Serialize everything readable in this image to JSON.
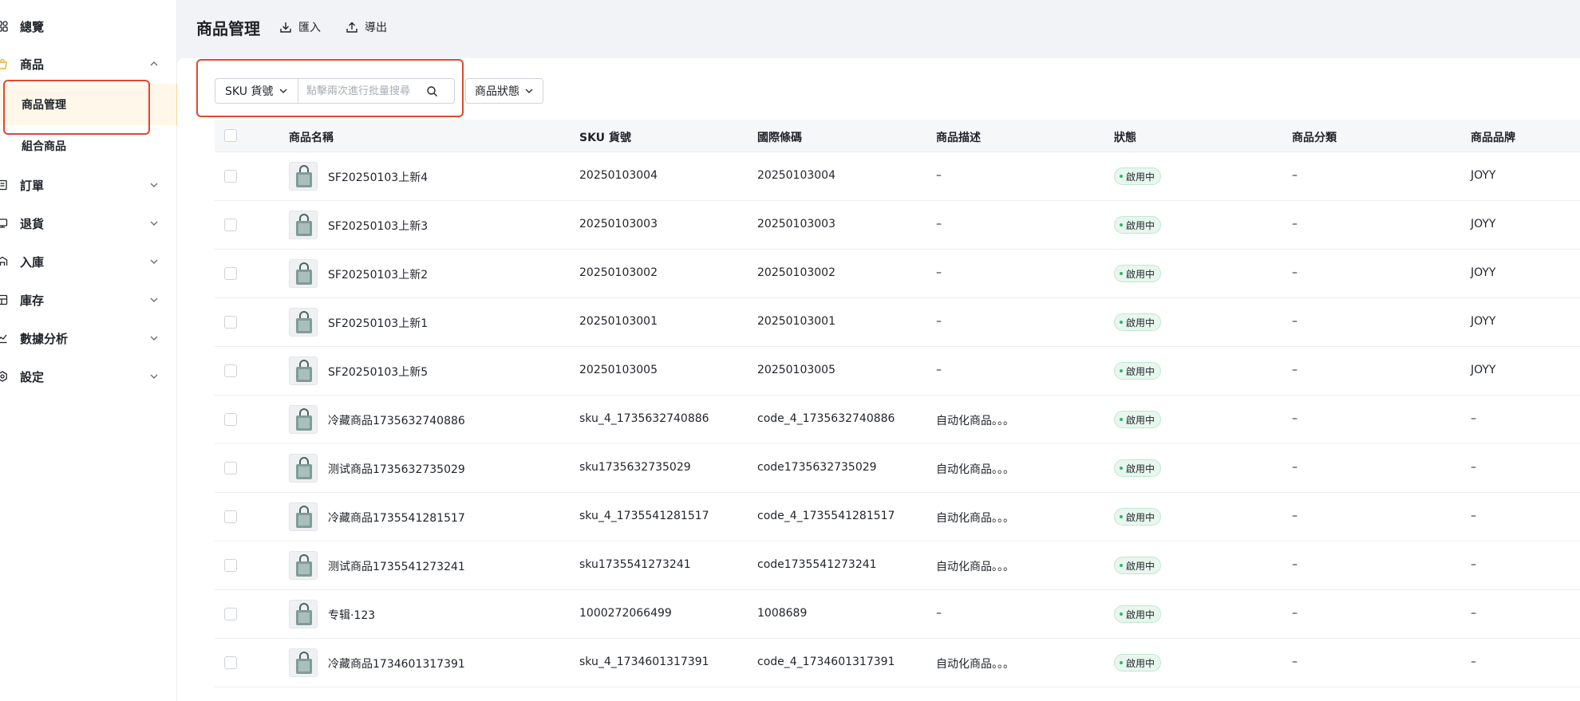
{
  "sidebar": {
    "items": [
      {
        "label": "總覽",
        "icon": "dashboard-icon"
      },
      {
        "label": "商品",
        "icon": "bag-icon",
        "expanded": true
      },
      {
        "label": "訂單",
        "icon": "order-icon"
      },
      {
        "label": "退貨",
        "icon": "return-icon"
      },
      {
        "label": "入庫",
        "icon": "inbound-icon"
      },
      {
        "label": "庫存",
        "icon": "stock-icon"
      },
      {
        "label": "數據分析",
        "icon": "chart-icon"
      },
      {
        "label": "設定",
        "icon": "gear-icon"
      }
    ],
    "sub_items": [
      {
        "label": "商品管理",
        "active": true
      },
      {
        "label": "組合商品",
        "active": false
      }
    ]
  },
  "header": {
    "title": "商品管理",
    "import_label": "匯入",
    "export_label": "導出"
  },
  "filter": {
    "sku_select": "SKU 貨號",
    "search_placeholder": "點擊兩次進行批量搜尋",
    "status_select": "商品狀態"
  },
  "table": {
    "columns": [
      "商品名稱",
      "SKU 貨號",
      "國際條碼",
      "商品描述",
      "狀態",
      "商品分類",
      "商品品牌"
    ],
    "rows": [
      {
        "name": "SF20250103上新4",
        "sku": "20250103004",
        "barcode": "20250103004",
        "desc": "–",
        "status": "啟用中",
        "category": "–",
        "brand": "JOYY"
      },
      {
        "name": "SF20250103上新3",
        "sku": "20250103003",
        "barcode": "20250103003",
        "desc": "–",
        "status": "啟用中",
        "category": "–",
        "brand": "JOYY"
      },
      {
        "name": "SF20250103上新2",
        "sku": "20250103002",
        "barcode": "20250103002",
        "desc": "–",
        "status": "啟用中",
        "category": "–",
        "brand": "JOYY"
      },
      {
        "name": "SF20250103上新1",
        "sku": "20250103001",
        "barcode": "20250103001",
        "desc": "–",
        "status": "啟用中",
        "category": "–",
        "brand": "JOYY"
      },
      {
        "name": "SF20250103上新5",
        "sku": "20250103005",
        "barcode": "20250103005",
        "desc": "–",
        "status": "啟用中",
        "category": "–",
        "brand": "JOYY"
      },
      {
        "name": "冷藏商品1735632740886",
        "sku": "sku_4_1735632740886",
        "barcode": "code_4_1735632740886",
        "desc": "自动化商品。。。",
        "status": "啟用中",
        "category": "–",
        "brand": "–"
      },
      {
        "name": "测试商品1735632735029",
        "sku": "sku1735632735029",
        "barcode": "code1735632735029",
        "desc": "自动化商品。。。",
        "status": "啟用中",
        "category": "–",
        "brand": "–"
      },
      {
        "name": "冷藏商品1735541281517",
        "sku": "sku_4_1735541281517",
        "barcode": "code_4_1735541281517",
        "desc": "自动化商品。。。",
        "status": "啟用中",
        "category": "–",
        "brand": "–"
      },
      {
        "name": "测试商品1735541273241",
        "sku": "sku1735541273241",
        "barcode": "code1735541273241",
        "desc": "自动化商品。。。",
        "status": "啟用中",
        "category": "–",
        "brand": "–"
      },
      {
        "name": "专辑·123",
        "sku": "1000272066499",
        "barcode": "1008689",
        "desc": "–",
        "status": "啟用中",
        "category": "–",
        "brand": "–"
      },
      {
        "name": "冷藏商品1734601317391",
        "sku": "sku_4_1734601317391",
        "barcode": "code_4_1734601317391",
        "desc": "自动化商品。。。",
        "status": "啟用中",
        "category": "–",
        "brand": "–"
      }
    ]
  },
  "colors": {
    "highlight": "#e2472f",
    "active_bg": "#fff8ea",
    "badge_bg": "#e8f7ee",
    "badge_dot": "#34b36a",
    "nav_accent": "#f0b429"
  }
}
